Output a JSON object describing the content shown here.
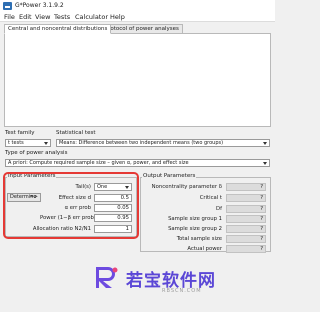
{
  "window": {
    "title": "G*Power 3.1.9.2"
  },
  "menu": [
    "File",
    "Edit",
    "View",
    "Tests",
    "Calculator",
    "Help"
  ],
  "tabs": [
    "Central and noncentral distributions",
    "Protocol of power analyses"
  ],
  "test_family": {
    "label": "Test family",
    "value": "t tests"
  },
  "statistical_test": {
    "label": "Statistical test",
    "value": "Means: Difference between two independent means (two groups)"
  },
  "analysis_type": {
    "label": "Type of power analysis",
    "value": "A priori: Compute required sample size – given α, power, and effect size"
  },
  "input_parameters": {
    "title": "Input Parameters",
    "determine_label": "Determine",
    "determine_arrow": "=>",
    "tails": {
      "label": "Tail(s)",
      "value": "One"
    },
    "rows": [
      {
        "label": "Effect size d",
        "value": "0.5"
      },
      {
        "label": "α err prob",
        "value": "0.05"
      },
      {
        "label": "Power (1−β err prob)",
        "value": "0.95"
      },
      {
        "label": "Allocation ratio N2/N1",
        "value": "1"
      }
    ]
  },
  "output_parameters": {
    "title": "Output Parameters",
    "rows": [
      {
        "label": "Noncentrality parameter δ",
        "value": "?"
      },
      {
        "label": "Critical t",
        "value": "?"
      },
      {
        "label": "Df",
        "value": "?"
      },
      {
        "label": "Sample size group 1",
        "value": "?"
      },
      {
        "label": "Sample size group 2",
        "value": "?"
      },
      {
        "label": "Total sample size",
        "value": "?"
      },
      {
        "label": "Actual power",
        "value": "?"
      }
    ]
  },
  "watermark": {
    "brand": "若宝软件网",
    "site": "RBSCN.COM"
  },
  "colors": {
    "highlight": "#e53935",
    "watermark": "#5b47d6"
  }
}
